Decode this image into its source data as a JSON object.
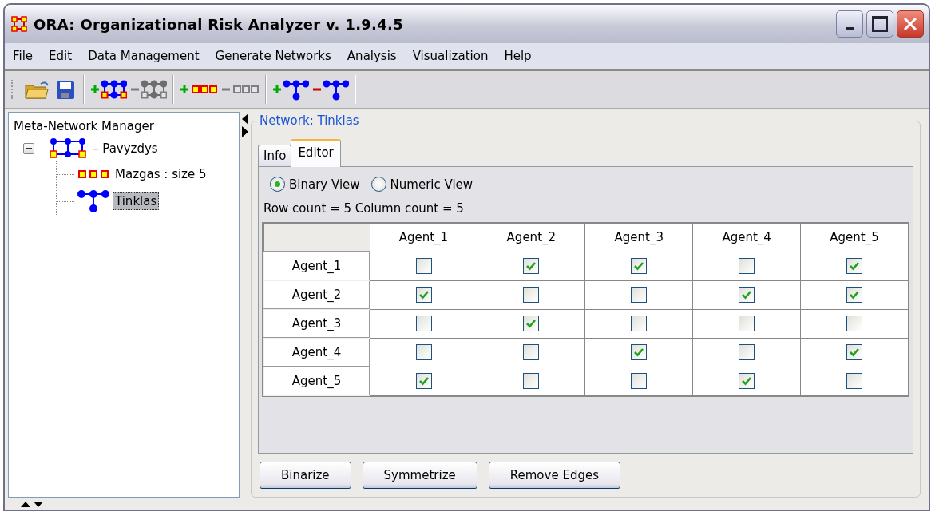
{
  "window": {
    "title": "ORA: Organizational Risk Analyzer v. 1.9.4.5"
  },
  "menu": [
    "File",
    "Edit",
    "Data Management",
    "Generate Networks",
    "Analysis",
    "Visualization",
    "Help"
  ],
  "toolbar": [
    [
      {
        "kind": "open",
        "disabled": false
      },
      {
        "kind": "save",
        "disabled": false
      }
    ],
    [
      {
        "kind": "add-meta",
        "disabled": false
      },
      {
        "kind": "remove-meta",
        "disabled": true
      }
    ],
    [
      {
        "kind": "add-nodes",
        "disabled": false
      },
      {
        "kind": "remove-nodes",
        "disabled": true
      }
    ],
    [
      {
        "kind": "add-graph",
        "disabled": false
      },
      {
        "kind": "remove-graph",
        "disabled": false
      }
    ]
  ],
  "sidebar": {
    "title": "Meta-Network Manager",
    "tree": [
      {
        "label": "– Pavyzdys",
        "kind": "meta",
        "expanded": true,
        "selected": false,
        "children": [
          {
            "label": "Mazgas : size 5",
            "kind": "nodes",
            "selected": false
          },
          {
            "label": "Tinklas",
            "kind": "graph",
            "selected": true
          }
        ]
      }
    ]
  },
  "panel": {
    "title": "Network: Tinklas",
    "tabs": [
      {
        "label": "Info",
        "selected": false
      },
      {
        "label": "Editor",
        "selected": true
      }
    ],
    "views": [
      {
        "label": "Binary View",
        "selected": true
      },
      {
        "label": "Numeric View",
        "selected": false
      }
    ],
    "counts": "Row count = 5 Column count = 5",
    "table": {
      "columns": [
        "Agent_1",
        "Agent_2",
        "Agent_3",
        "Agent_4",
        "Agent_5"
      ],
      "rows": [
        {
          "label": "Agent_1",
          "cells": [
            false,
            true,
            true,
            false,
            true
          ]
        },
        {
          "label": "Agent_2",
          "cells": [
            true,
            false,
            false,
            true,
            true
          ]
        },
        {
          "label": "Agent_3",
          "cells": [
            false,
            true,
            false,
            false,
            false
          ]
        },
        {
          "label": "Agent_4",
          "cells": [
            false,
            false,
            true,
            false,
            true
          ]
        },
        {
          "label": "Agent_5",
          "cells": [
            true,
            false,
            false,
            true,
            false
          ]
        }
      ]
    },
    "buttons": [
      "Binarize",
      "Symmetrize",
      "Remove Edges"
    ]
  }
}
